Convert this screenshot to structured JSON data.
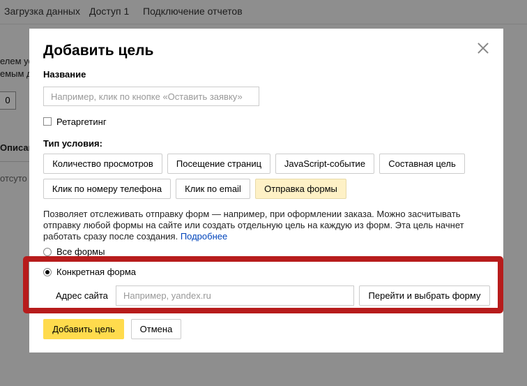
{
  "background": {
    "tabs": [
      "Загрузка данных",
      "Доступ 1",
      "Подключение отчетов"
    ],
    "fragments": [
      "елем ус",
      "емым д",
      "0",
      "Описан",
      "отсуто"
    ]
  },
  "modal": {
    "title": "Добавить цель",
    "name_label": "Название",
    "name_placeholder": "Например, клик по кнопке «Оставить заявку»",
    "retargeting_label": "Ретаргетинг",
    "condition_label": "Тип условия:",
    "condition_types": [
      {
        "label": "Количество просмотров",
        "selected": false
      },
      {
        "label": "Посещение страниц",
        "selected": false
      },
      {
        "label": "JavaScript-событие",
        "selected": false
      },
      {
        "label": "Составная цель",
        "selected": false
      },
      {
        "label": "Клик по номеру телефона",
        "selected": false
      },
      {
        "label": "Клик по email",
        "selected": false
      },
      {
        "label": "Отправка формы",
        "selected": true
      }
    ],
    "description": "Позволяет отслеживать отправку форм — например, при оформлении заказа. Можно засчитывать отправку любой формы на сайте или создать отдельную цель на каждую из форм. Эта цель начнет работать сразу после создания. ",
    "description_link": "Подробнее",
    "radio_all_forms": "Все формы",
    "radio_specific_form": "Конкретная форма",
    "site_label": "Адрес сайта",
    "site_placeholder": "Например, yandex.ru",
    "go_select_button": "Перейти и выбрать форму",
    "add_button": "Добавить цель",
    "cancel_button": "Отмена"
  },
  "colors": {
    "primary": "#ffdb4d",
    "selected": "#fef1c6",
    "highlight": "#b71c1c",
    "link": "#0044bb"
  },
  "icons": [
    "close-icon",
    "checkbox-icon",
    "radio-icon"
  ]
}
